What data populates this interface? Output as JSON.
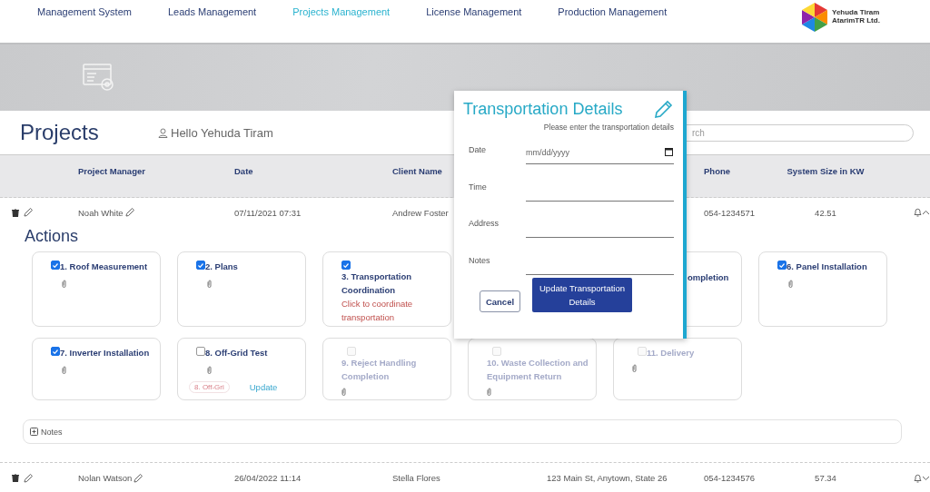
{
  "nav": {
    "items": [
      {
        "label": "Management System",
        "selected": false
      },
      {
        "label": "Leads Management",
        "selected": false
      },
      {
        "label": "Projects Management",
        "selected": true
      },
      {
        "label": "License Management",
        "selected": false
      },
      {
        "label": "Production Management",
        "selected": false
      }
    ],
    "logo_text": "Yehuda Tiram AtarimTR Ltd."
  },
  "page": {
    "title": "Projects",
    "greeting": "Hello Yehuda Tiram",
    "search": {
      "placeholder": "rch"
    }
  },
  "table": {
    "columns": [
      {
        "label": "Project Manager"
      },
      {
        "label": "Date"
      },
      {
        "label": "Client Name"
      },
      {},
      {
        "label": "Phone"
      },
      {
        "label": "System Size in KW"
      }
    ],
    "rows": [
      {
        "manager": "Noah White",
        "date": "07/11/2021 07:31",
        "client": "Andrew Foster",
        "phone": "054-1234571",
        "size": "42.51",
        "expanded": true
      },
      {
        "manager": "Nolan Watson",
        "date": "26/04/2022 11:14",
        "client": "Stella Flores",
        "address": "123 Main St, Anytown, State 26",
        "phone": "054-1234576",
        "size": "57.34",
        "expanded": false
      }
    ]
  },
  "actions": {
    "title": "Actions",
    "items": [
      {
        "kind": "task",
        "title": "1. Roof Measurement",
        "checked": true,
        "disabled": false,
        "attachment": true
      },
      {
        "kind": "task",
        "title": "2. Plans",
        "checked": true,
        "disabled": false,
        "attachment": true
      },
      {
        "kind": "task",
        "title": "3. Transportation Coordination",
        "checked": true,
        "disabled": false,
        "link": "Click to coordinate transportation",
        "attachment": false
      },
      {
        "kind": "covered"
      },
      {
        "kind": "partial",
        "title": "ompletion"
      },
      {
        "kind": "task",
        "title": "6. Panel Installation",
        "checked": true,
        "disabled": false,
        "attachment": true
      },
      {
        "kind": "task",
        "title": "7. Inverter Installation",
        "checked": true,
        "disabled": false,
        "attachment": true
      },
      {
        "kind": "task",
        "title": "8. Off-Grid Test",
        "checked": false,
        "disabled": false,
        "tag": "8. Off-Gri",
        "action": "Update",
        "attachment": true
      },
      {
        "kind": "task",
        "title": "9. Reject Handling Completion",
        "checked": false,
        "disabled": true,
        "attachment": true
      },
      {
        "kind": "task",
        "title": "10. Waste Collection and Equipment Return",
        "checked": false,
        "disabled": true,
        "attachment": true
      },
      {
        "kind": "task",
        "title": "11. Delivery",
        "checked": false,
        "disabled": true,
        "attachment": true
      }
    ],
    "notes_label": "Notes"
  },
  "dialog": {
    "title": "Transportation Details",
    "subtitle": "Please enter the transportation details",
    "fields": [
      {
        "label": "Date",
        "kind": "date",
        "placeholder": "mm/dd/yyyy"
      },
      {
        "label": "Time",
        "kind": "text"
      },
      {
        "label": "Address",
        "kind": "text"
      },
      {
        "label": "Notes",
        "kind": "text"
      }
    ],
    "cancel": "Cancel",
    "submit": "Update Transportation Details"
  }
}
